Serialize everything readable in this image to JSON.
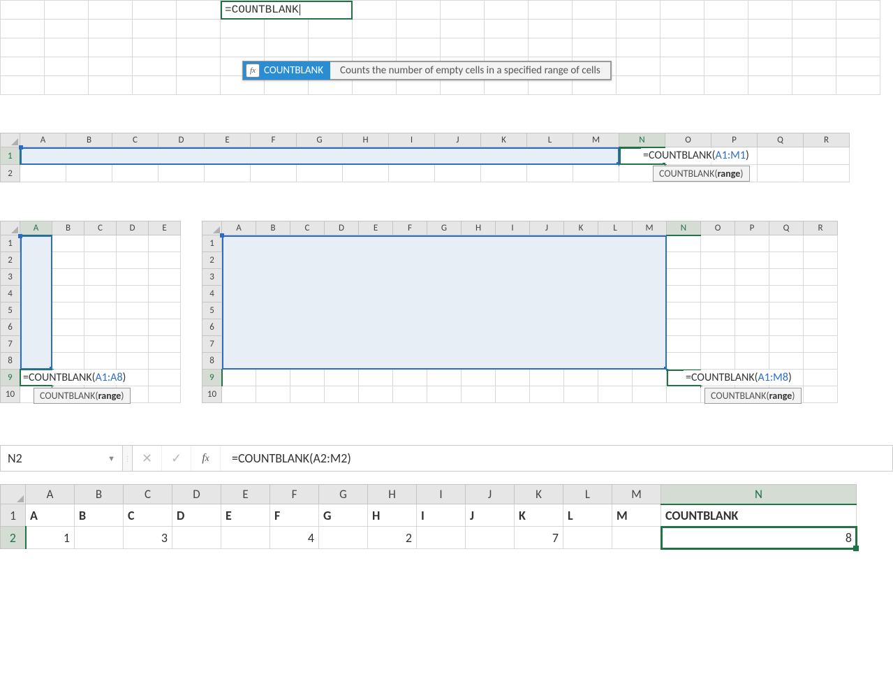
{
  "panel1": {
    "edit_text": "=COUNTBLANK",
    "autocomplete_item": "COUNTBLANK",
    "autocomplete_desc": "Counts the number of empty cells in a specified range of cells"
  },
  "panel2": {
    "cols": [
      "A",
      "B",
      "C",
      "D",
      "E",
      "F",
      "G",
      "H",
      "I",
      "J",
      "K",
      "L",
      "M",
      "N",
      "O",
      "P",
      "Q",
      "R"
    ],
    "rows": [
      "1",
      "2"
    ],
    "formula_prefix": "=COUNTBLANK(",
    "formula_ref": "A1:M1",
    "formula_suffix": ")",
    "hint_fn": "COUNTBLANK",
    "hint_arg": "range"
  },
  "panel3": {
    "cols": [
      "A",
      "B",
      "C",
      "D",
      "E"
    ],
    "rows": [
      "1",
      "2",
      "3",
      "4",
      "5",
      "6",
      "7",
      "8",
      "9",
      "10"
    ],
    "formula_prefix": "=COUNTBLANK(",
    "formula_ref": "A1:A8",
    "formula_suffix": ")",
    "hint_fn": "COUNTBLANK",
    "hint_arg": "range"
  },
  "panel4": {
    "cols": [
      "A",
      "B",
      "C",
      "D",
      "E",
      "F",
      "G",
      "H",
      "I",
      "J",
      "K",
      "L",
      "M",
      "N",
      "O",
      "P",
      "Q",
      "R"
    ],
    "rows": [
      "1",
      "2",
      "3",
      "4",
      "5",
      "6",
      "7",
      "8",
      "9",
      "10"
    ],
    "formula_prefix": "=COUNTBLANK(",
    "formula_ref": "A1:M8",
    "formula_suffix": ")",
    "hint_fn": "COUNTBLANK",
    "hint_arg": "range"
  },
  "panel5": {
    "namebox": "N2",
    "formula_bar": "=COUNTBLANK(A2:M2)",
    "cols": [
      "A",
      "B",
      "C",
      "D",
      "E",
      "F",
      "G",
      "H",
      "I",
      "J",
      "K",
      "L",
      "M",
      "N"
    ],
    "rows": [
      "1",
      "2"
    ],
    "row1": [
      "A",
      "B",
      "C",
      "D",
      "E",
      "F",
      "G",
      "H",
      "I",
      "J",
      "K",
      "L",
      "M",
      "COUNTBLANK"
    ],
    "row2": [
      "1",
      "",
      "3",
      "",
      "",
      "4",
      "",
      "2",
      "",
      "",
      "7",
      "",
      "",
      "8"
    ]
  }
}
